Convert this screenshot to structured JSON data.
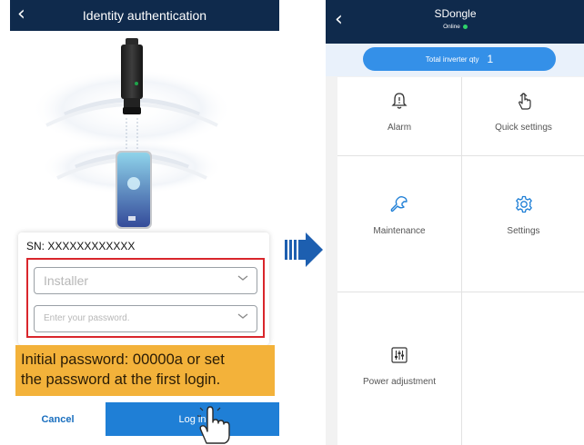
{
  "left_screen": {
    "title": "Identity authentication",
    "sn_text": "SN: XXXXXXXXXXXX",
    "username_placeholder": "Installer",
    "password_placeholder": "Enter your password.",
    "note_line1": "Initial password: 00000a or set",
    "note_line2": "the password at the first login.",
    "cancel_label": "Cancel",
    "login_label": "Log in",
    "note_color": "#f3b23a",
    "highlight_color": "#d9262c"
  },
  "right_screen": {
    "title": "SDongle",
    "status": "Online",
    "status_color": "#2ed36a",
    "inverter_qty_label": "Total inverter qty",
    "inverter_qty_value": "1",
    "tiles": [
      {
        "label": "Alarm",
        "icon": "alarm-bell-icon"
      },
      {
        "label": "Quick settings",
        "icon": "quick-settings-hand-icon"
      },
      {
        "label": "Maintenance",
        "icon": "maintenance-wrench-icon"
      },
      {
        "label": "Settings",
        "icon": "settings-gear-icon"
      },
      {
        "label": "Power adjustment",
        "icon": "power-adjustment-sliders-icon"
      }
    ]
  },
  "colors": {
    "header": "#0f2a4c",
    "accent_blue": "#1f7fd6",
    "arrow_blue": "#1d5fb0"
  }
}
